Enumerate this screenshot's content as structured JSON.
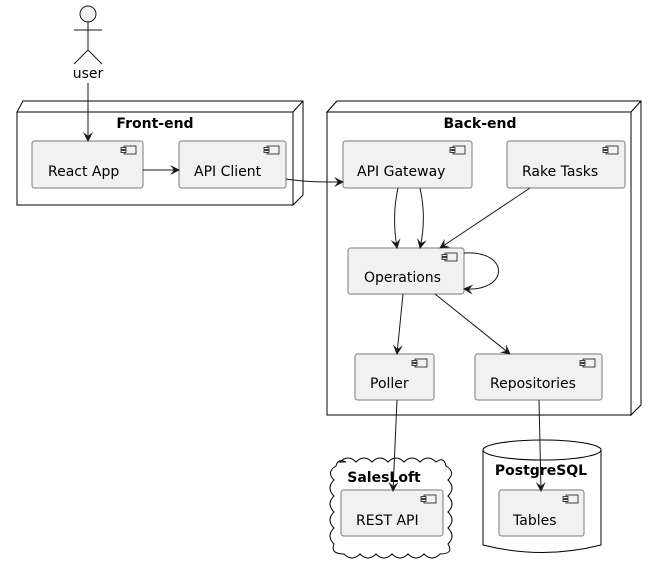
{
  "actor": {
    "label": "user"
  },
  "containers": {
    "frontend": {
      "title": "Front-end",
      "shape": "node"
    },
    "backend": {
      "title": "Back-end",
      "shape": "node"
    },
    "salesloft": {
      "title": "SalesLoft",
      "shape": "cloud"
    },
    "postgres": {
      "title": "PostgreSQL",
      "shape": "database"
    }
  },
  "components": {
    "react_app": "React App",
    "api_client": "API Client",
    "api_gateway": "API Gateway",
    "rake_tasks": "Rake Tasks",
    "operations": "Operations",
    "poller": "Poller",
    "repositories": "Repositories",
    "rest_api": "REST API",
    "tables": "Tables"
  },
  "edges": [
    [
      "user",
      "React App"
    ],
    [
      "React App",
      "API Client"
    ],
    [
      "API Client",
      "API Gateway"
    ],
    [
      "API Gateway",
      "Operations"
    ],
    [
      "API Gateway",
      "Operations"
    ],
    [
      "Rake Tasks",
      "Operations"
    ],
    [
      "Operations",
      "Operations"
    ],
    [
      "Operations",
      "Poller"
    ],
    [
      "Operations",
      "Repositories"
    ],
    [
      "Poller",
      "REST API"
    ],
    [
      "Repositories",
      "Tables"
    ]
  ]
}
